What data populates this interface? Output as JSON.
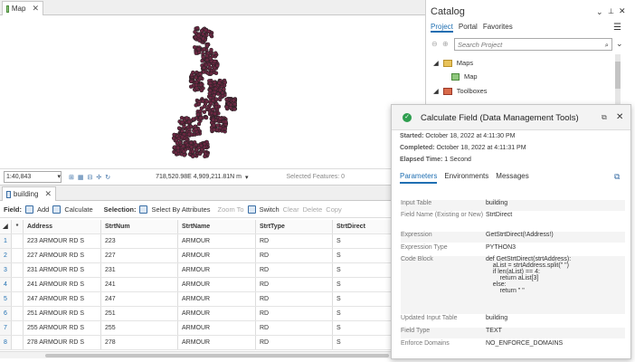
{
  "map_tab": {
    "label": "Map"
  },
  "map_status": {
    "scale": "1:40,843",
    "coords": "718,520.98E 4,909,211.81N m",
    "selected": "Selected Features: 0"
  },
  "table_tab": {
    "label": "building"
  },
  "table_toolbar": {
    "field_label": "Field:",
    "add": "Add",
    "calculate": "Calculate",
    "selection_label": "Selection:",
    "select_by_attr": "Select By Attributes",
    "zoom_to": "Zoom To",
    "switch": "Switch",
    "clear": "Clear",
    "delete": "Delete",
    "copy": "Copy"
  },
  "table": {
    "columns": [
      "Address",
      "StrtNum",
      "StrtName",
      "StrtType",
      "StrtDirect"
    ],
    "rows": [
      {
        "n": "1",
        "Address": "223 ARMOUR RD S",
        "StrtNum": "223",
        "StrtName": "ARMOUR",
        "StrtType": "RD",
        "StrtDirect": "S"
      },
      {
        "n": "2",
        "Address": "227 ARMOUR RD S",
        "StrtNum": "227",
        "StrtName": "ARMOUR",
        "StrtType": "RD",
        "StrtDirect": "S"
      },
      {
        "n": "3",
        "Address": "231 ARMOUR RD S",
        "StrtNum": "231",
        "StrtName": "ARMOUR",
        "StrtType": "RD",
        "StrtDirect": "S"
      },
      {
        "n": "4",
        "Address": "241 ARMOUR RD S",
        "StrtNum": "241",
        "StrtName": "ARMOUR",
        "StrtType": "RD",
        "StrtDirect": "S"
      },
      {
        "n": "5",
        "Address": "247 ARMOUR RD S",
        "StrtNum": "247",
        "StrtName": "ARMOUR",
        "StrtType": "RD",
        "StrtDirect": "S"
      },
      {
        "n": "6",
        "Address": "251 ARMOUR RD S",
        "StrtNum": "251",
        "StrtName": "ARMOUR",
        "StrtType": "RD",
        "StrtDirect": "S"
      },
      {
        "n": "7",
        "Address": "255 ARMOUR RD S",
        "StrtNum": "255",
        "StrtName": "ARMOUR",
        "StrtType": "RD",
        "StrtDirect": "S"
      },
      {
        "n": "8",
        "Address": "278 ARMOUR RD S",
        "StrtNum": "278",
        "StrtName": "ARMOUR",
        "StrtType": "RD",
        "StrtDirect": "S"
      }
    ]
  },
  "catalog": {
    "title": "Catalog",
    "tabs": [
      "Project",
      "Portal",
      "Favorites"
    ],
    "search_placeholder": "Search Project",
    "maps": "Maps",
    "map": "Map",
    "toolboxes": "Toolboxes"
  },
  "gp": {
    "title": "Calculate Field (Data Management Tools)",
    "started_label": "Started:",
    "started": "October 18, 2022 at 4:11:30 PM",
    "completed_label": "Completed:",
    "completed": "October 18, 2022 at 4:11:31 PM",
    "elapsed_label": "Elapsed Time:",
    "elapsed": "1 Second",
    "tabs": [
      "Parameters",
      "Environments",
      "Messages"
    ],
    "params": [
      {
        "label": "Input Table",
        "value": "building"
      },
      {
        "label": "Field Name (Existing or New)",
        "value": "StrtDirect"
      },
      {
        "label": "Expression",
        "value": "GetStrtDirect(!Address!)"
      },
      {
        "label": "Expression Type",
        "value": "PYTHON3"
      },
      {
        "label": "Code Block",
        "value": "def GetStrtDirect(strtAddress):\n    aList = strtAddress.split(\" \")\n    if len(aList) == 4:\n        return aList[3]\n    else:\n        return \" \""
      },
      {
        "label": "Updated Input Table",
        "value": "building"
      },
      {
        "label": "Field Type",
        "value": "TEXT"
      },
      {
        "label": "Enforce Domains",
        "value": "NO_ENFORCE_DOMAINS"
      }
    ]
  },
  "colors": {
    "accent": "#1f6fb2",
    "point_fill": "#6b2742",
    "success": "#2e9e4f"
  }
}
